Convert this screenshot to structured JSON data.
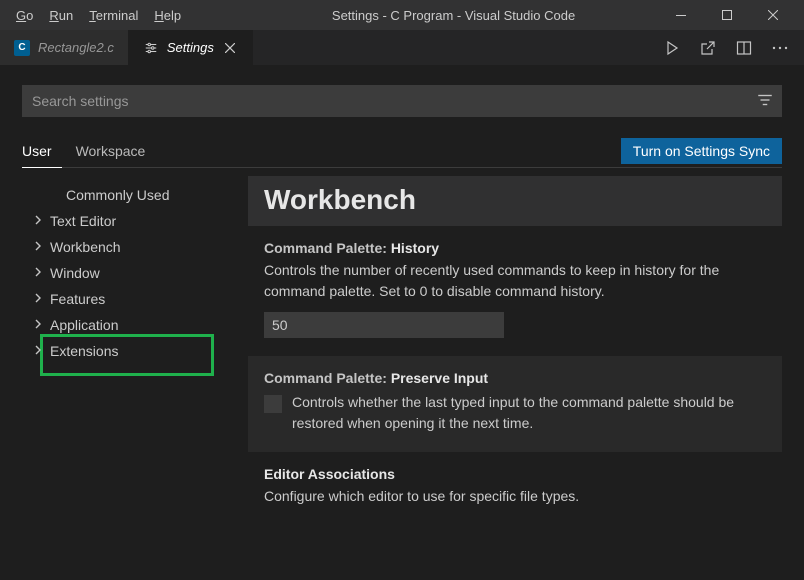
{
  "menubar": {
    "go": "Go",
    "run": "Run",
    "terminal": "Terminal",
    "help": "Help"
  },
  "window_title": "Settings - C Program - Visual Studio Code",
  "tabs": {
    "file": {
      "label": "Rectangle2.c"
    },
    "settings": {
      "label": "Settings"
    }
  },
  "search": {
    "placeholder": "Search settings"
  },
  "scope": {
    "user": "User",
    "workspace": "Workspace"
  },
  "sync_button": "Turn on Settings Sync",
  "tree": {
    "commonly_used": "Commonly Used",
    "text_editor": "Text Editor",
    "workbench": "Workbench",
    "window": "Window",
    "features": "Features",
    "application": "Application",
    "extensions": "Extensions"
  },
  "content": {
    "heading": "Workbench",
    "history": {
      "title_prefix": "Command Palette: ",
      "title": "History",
      "desc": "Controls the number of recently used commands to keep in history for the command palette. Set to 0 to disable command history.",
      "value": "50"
    },
    "preserve": {
      "title_prefix": "Command Palette: ",
      "title": "Preserve Input",
      "desc": "Controls whether the last typed input to the command palette should be restored when opening it the next time."
    },
    "assoc": {
      "title": "Editor Associations",
      "desc": "Configure which editor to use for specific file types."
    }
  }
}
